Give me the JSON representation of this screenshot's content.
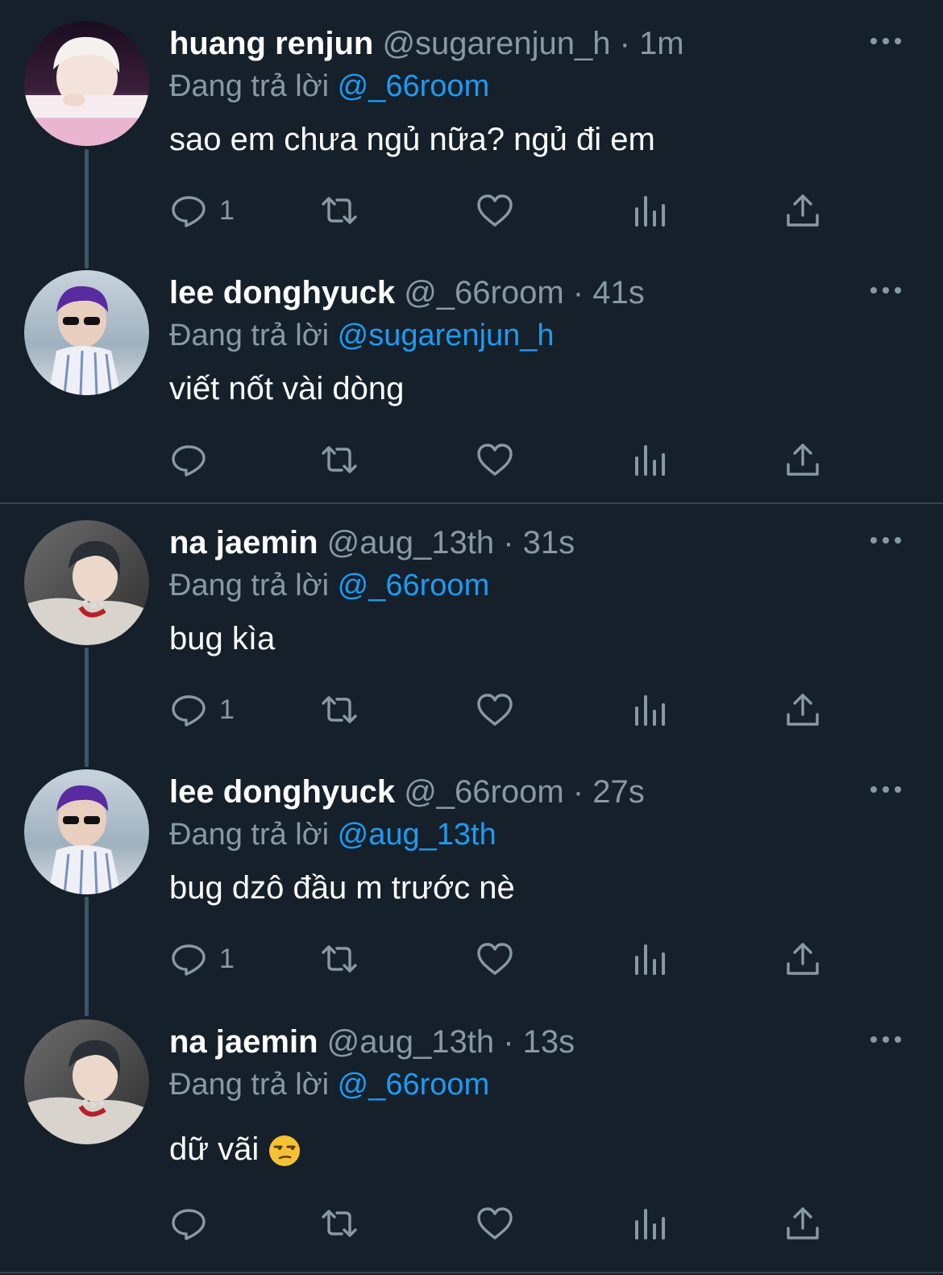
{
  "reply_prefix": "Đang trả lời",
  "colors": {
    "background": "#15202b",
    "muted": "#8899a6",
    "link": "#1d9bf0",
    "thread_line": "#3d5466",
    "divider": "#38444d"
  },
  "tweets": [
    {
      "name": "huang renjun",
      "handle": "@sugarenjun_h",
      "time": "1m",
      "reply_to": "@_66room",
      "text": "sao em chưa ngủ nữa? ngủ đi em",
      "reply_count": "1",
      "avatar": "avatar-renjun"
    },
    {
      "name": "lee donghyuck",
      "handle": "@_66room",
      "time": "41s",
      "reply_to": "@sugarenjun_h",
      "text": "viết nốt vài dòng",
      "reply_count": "",
      "avatar": "avatar-donghyuck"
    },
    {
      "name": "na jaemin",
      "handle": "@aug_13th",
      "time": "31s",
      "reply_to": "@_66room",
      "text": "bug kìa",
      "reply_count": "1",
      "avatar": "avatar-jaemin"
    },
    {
      "name": "lee donghyuck",
      "handle": "@_66room",
      "time": "27s",
      "reply_to": "@aug_13th",
      "text": "bug dzô đầu m trước nè",
      "reply_count": "1",
      "avatar": "avatar-donghyuck"
    },
    {
      "name": "na jaemin",
      "handle": "@aug_13th",
      "time": "13s",
      "reply_to": "@_66room",
      "text": "dữ vãi",
      "emoji": "unamused-face-emoji",
      "reply_count": "",
      "avatar": "avatar-jaemin"
    }
  ],
  "icons": [
    "reply-icon",
    "retweet-icon",
    "like-icon",
    "analytics-icon",
    "share-icon",
    "more-icon"
  ]
}
